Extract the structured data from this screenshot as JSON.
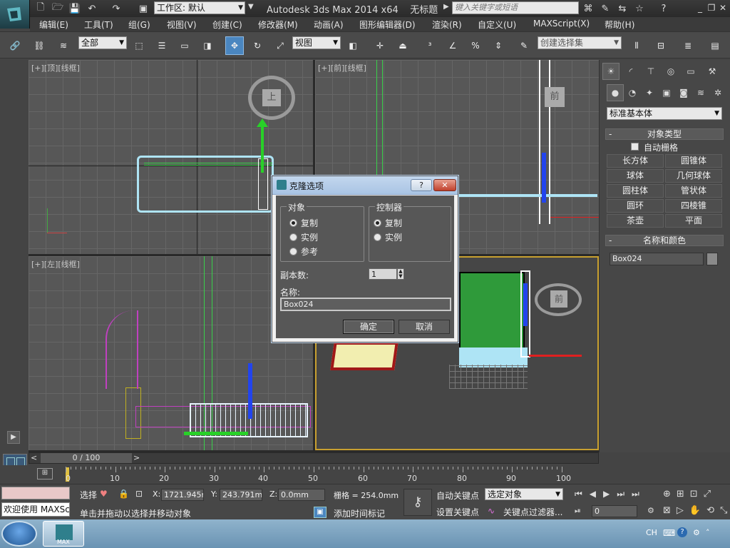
{
  "titlebar": {
    "workspace_label": "工作区: 默认",
    "app_title": "Autodesk 3ds Max  2014 x64",
    "doc_title": "无标题",
    "search_placeholder": "键入关键字或短语"
  },
  "menubar": {
    "items": [
      "编辑(E)",
      "工具(T)",
      "组(G)",
      "视图(V)",
      "创建(C)",
      "修改器(M)",
      "动画(A)",
      "图形编辑器(D)",
      "渲染(R)",
      "自定义(U)",
      "MAXScript(X)",
      "帮助(H)"
    ]
  },
  "toolbar": {
    "filter_value": "全部",
    "refcoord_value": "视图",
    "selection_set_placeholder": "创建选择集"
  },
  "viewports": {
    "top_label": "[+][顶][线框]",
    "front_label": "[+][前][线框]",
    "left_label": "[+][左][线框]",
    "persp_label": "",
    "viewcube_top": "上",
    "viewcube_front": "前"
  },
  "command_panel": {
    "category_value": "标准基本体",
    "object_type_header": "对象类型",
    "autogrid_label": "自动栅格",
    "buttons": [
      "长方体",
      "圆锥体",
      "球体",
      "几何球体",
      "圆柱体",
      "管状体",
      "圆环",
      "四棱锥",
      "茶壶",
      "平面"
    ],
    "name_color_header": "名称和颜色",
    "object_name": "Box024",
    "object_color": "#8a8a8a"
  },
  "dialog": {
    "title": "克隆选项",
    "help_label": "?",
    "object_group": "对象",
    "object_options": [
      "复制",
      "实例",
      "参考"
    ],
    "object_selected": 0,
    "controller_group": "控制器",
    "controller_options": [
      "复制",
      "实例"
    ],
    "controller_selected": 0,
    "copies_label": "副本数:",
    "copies_value": "1",
    "name_label": "名称:",
    "name_value": "Box024",
    "ok_label": "确定",
    "cancel_label": "取消"
  },
  "timeline": {
    "frame_display": "0 / 100",
    "ticks": [
      "0",
      "10",
      "20",
      "30",
      "40",
      "50",
      "60",
      "70",
      "80",
      "90",
      "100"
    ]
  },
  "status": {
    "maxscript_label": "欢迎使用 MAXSc",
    "selection_label": "选择",
    "x_label": "X:",
    "x_value": "1721.945m",
    "y_label": "Y:",
    "y_value": "243.791mr",
    "z_label": "Z:",
    "z_value": "0.0mm",
    "grid_label": "栅格 = 254.0mm",
    "prompt": "单击并拖动以选择并移动对象",
    "add_time_tag": "添加时间标记",
    "auto_key": "自动关键点",
    "set_key": "设置关键点",
    "key_mode_value": "选定对象",
    "key_filters": "关键点过滤器...",
    "current_frame": "0"
  },
  "taskbar": {
    "lang": "CH",
    "app_button": "MAX"
  }
}
